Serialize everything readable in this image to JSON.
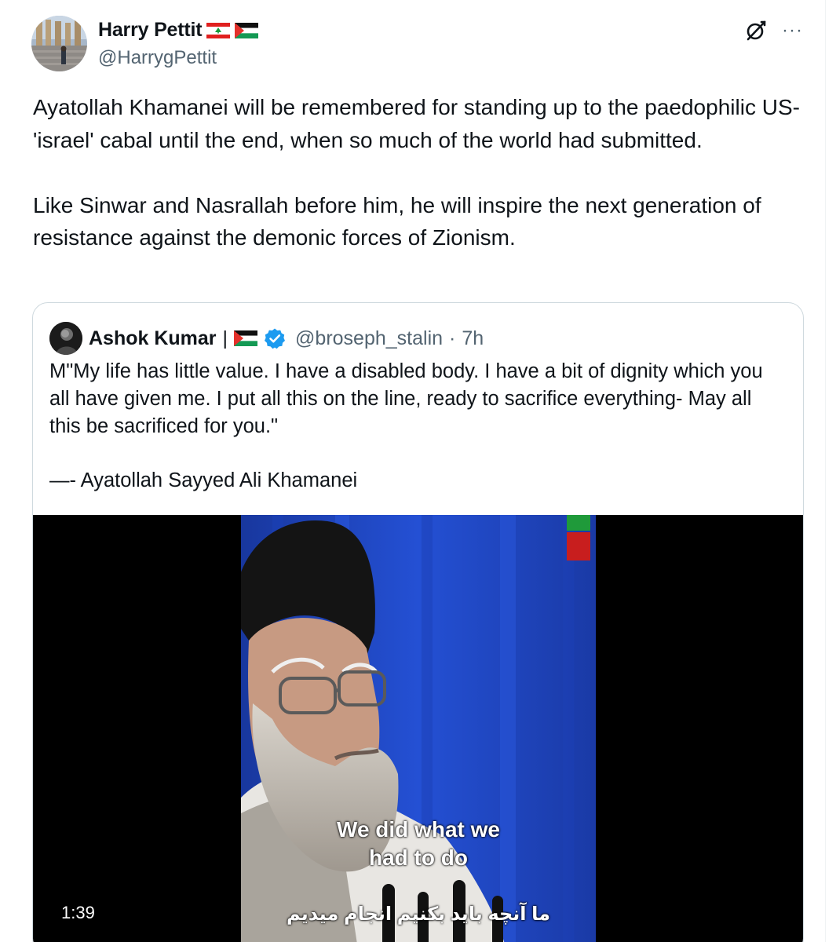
{
  "post": {
    "author": {
      "display_name": "Harry Pettit",
      "flags": [
        "lebanon-flag",
        "palestine-flag"
      ],
      "handle": "@HarrygPettit"
    },
    "actions": {
      "grok_icon": "grok-slash-circle-icon",
      "more_icon": "more-horizontal-icon",
      "more_glyph": "···"
    },
    "text": {
      "paragraph_1": "Ayatollah Khamanei will be remembered for standing up to the paedophilic US-'israel' cabal until the end, when so much of the world had submitted.",
      "paragraph_2": "Like Sinwar and Nasrallah before him, he will inspire the next generation of resistance against the demonic forces of Zionism."
    }
  },
  "quoted_post": {
    "author": {
      "display_name": "Ashok Kumar",
      "separator": "|",
      "flag": "palestine-flag",
      "verified_icon": "verified-badge-icon",
      "handle": "@broseph_stalin",
      "dot": "·",
      "time": "7h"
    },
    "text": {
      "quote_lines": "M\"My life has little value. I have a disabled body. I have a bit of dignity which you all have given me. I put all this on the line, ready to sacrifice everything- May all this be sacrificed for you.\"",
      "attribution": "—- Ayatollah Sayyed Ali Khamanei"
    },
    "video": {
      "subtitle_line_1": "We did what we",
      "subtitle_line_2": "had to do",
      "subtitle_farsi": "ما آنچه باید بکنیم انجام میدیم",
      "duration": "1:39"
    }
  },
  "colors": {
    "text_primary": "#0f1419",
    "text_secondary": "#536471",
    "border": "#cfd9de",
    "verified_blue": "#1d9bf0",
    "video_bg": "#000000",
    "backdrop_blue": "#1f47c8"
  }
}
